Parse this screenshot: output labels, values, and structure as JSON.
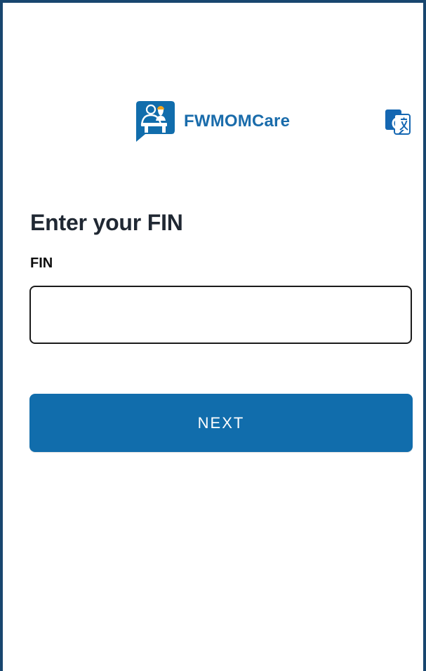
{
  "app": {
    "name": "FWMOMCare",
    "logo_icon": "worker-chat-logo",
    "translate_icon": "google-translate-icon"
  },
  "screen": {
    "title": "Enter your FIN"
  },
  "form": {
    "fin_label": "FIN",
    "fin_value": "",
    "fin_placeholder": "",
    "next_label": "NEXT"
  },
  "colors": {
    "brand_blue": "#116dac",
    "frame_border": "#18466f",
    "title_text": "#202833"
  }
}
